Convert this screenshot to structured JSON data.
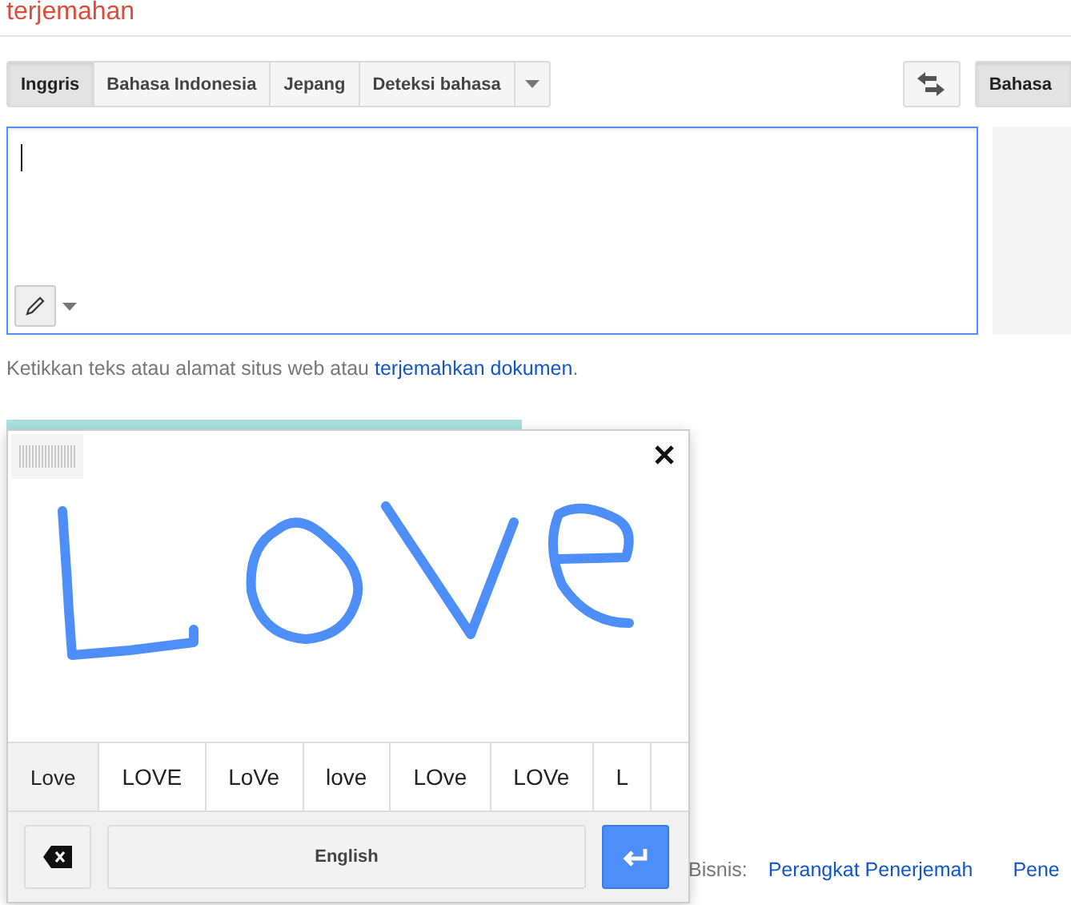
{
  "header": {
    "title": "terjemahan"
  },
  "source_languages": [
    {
      "label": "Inggris",
      "selected": true
    },
    {
      "label": "Bahasa Indonesia",
      "selected": false
    },
    {
      "label": "Jepang",
      "selected": false
    },
    {
      "label": "Deteksi bahasa",
      "selected": false
    }
  ],
  "target_languages": [
    {
      "label": "Bahasa",
      "selected": true
    }
  ],
  "help_text": {
    "text": "Ketikkan teks atau alamat situs web atau ",
    "link": "terjemahkan dokumen",
    "suffix": "."
  },
  "handwriting": {
    "candidates": [
      {
        "label": "Love",
        "selected": true
      },
      {
        "label": "LOVE",
        "selected": false
      },
      {
        "label": "LoVe",
        "selected": false
      },
      {
        "label": "love",
        "selected": false
      },
      {
        "label": "LOve",
        "selected": false
      },
      {
        "label": "LOVe",
        "selected": false
      },
      {
        "label": "L",
        "selected": false
      }
    ],
    "input_language": "English"
  },
  "footer": {
    "label": "Bisnis:",
    "links": [
      "Perangkat Penerjemah",
      "Pene"
    ]
  }
}
